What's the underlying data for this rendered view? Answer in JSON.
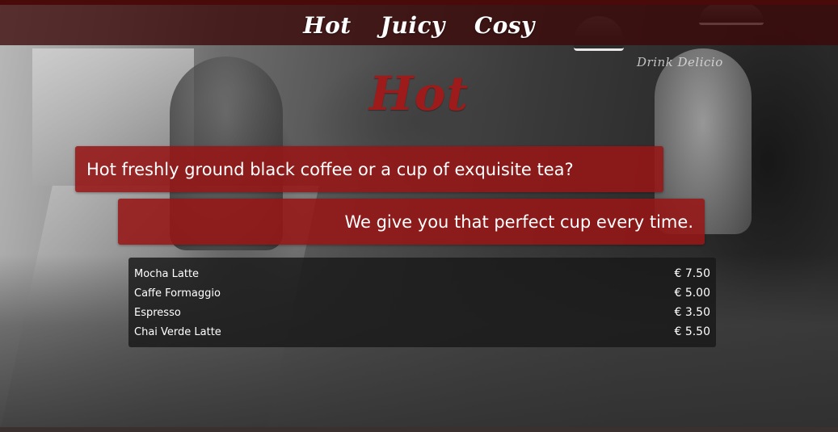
{
  "nav": {
    "items": [
      {
        "label": "Hot"
      },
      {
        "label": "Juicy"
      },
      {
        "label": "Cosy"
      }
    ]
  },
  "background": {
    "sign_text": "Drink Delicio"
  },
  "section": {
    "title": "Hot",
    "tagline_1": "Hot freshly ground black coffee or a cup of exquisite tea?",
    "tagline_2": "We give you that perfect cup every time."
  },
  "menu": {
    "items": [
      {
        "name": "Mocha Latte",
        "price": "€ 7.50"
      },
      {
        "name": "Caffe Formaggio",
        "price": "€ 5.00"
      },
      {
        "name": "Espresso",
        "price": "€ 3.50"
      },
      {
        "name": "Chai Verde Latte",
        "price": "€ 5.50"
      }
    ]
  },
  "colors": {
    "nav_bg": "#3c0808",
    "accent_red": "#9e1b1b",
    "banner_bg": "#961616",
    "menu_bg": "#191919"
  }
}
